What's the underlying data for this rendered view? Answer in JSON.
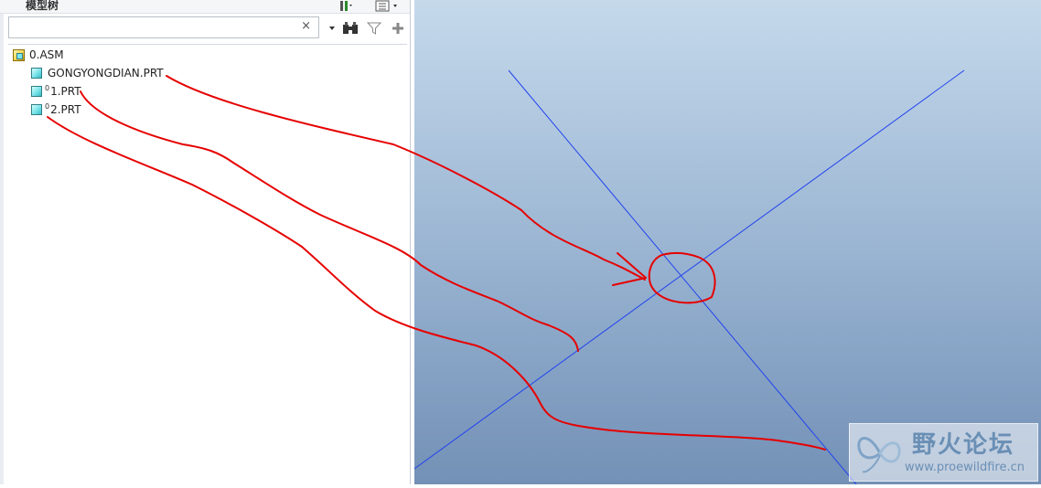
{
  "model_tree": {
    "title": "模型树",
    "search": {
      "value": "",
      "clear": "×"
    },
    "items": [
      {
        "label": "0.ASM",
        "type": "assembly",
        "marker": ""
      },
      {
        "label": "GONGYONGDIAN.PRT",
        "type": "part",
        "marker": ""
      },
      {
        "label": "1.PRT",
        "type": "part",
        "marker": "0"
      },
      {
        "label": "2.PRT",
        "type": "part",
        "marker": "0"
      }
    ]
  },
  "toolbar": {
    "icons": [
      "settings-icon",
      "tree-filter-icon",
      "dropdown-icon",
      "binoculars-icon",
      "filter-icon",
      "add-icon"
    ]
  },
  "colors": {
    "axis_line": "#2244ee",
    "annotation": "#e60000",
    "cube_fill": "#6fe0e6",
    "viewport_top": "#c5d9eb",
    "viewport_bottom": "#7390b6"
  },
  "watermark": {
    "title": "野火论坛",
    "url": "www.proewildfire.cn"
  }
}
